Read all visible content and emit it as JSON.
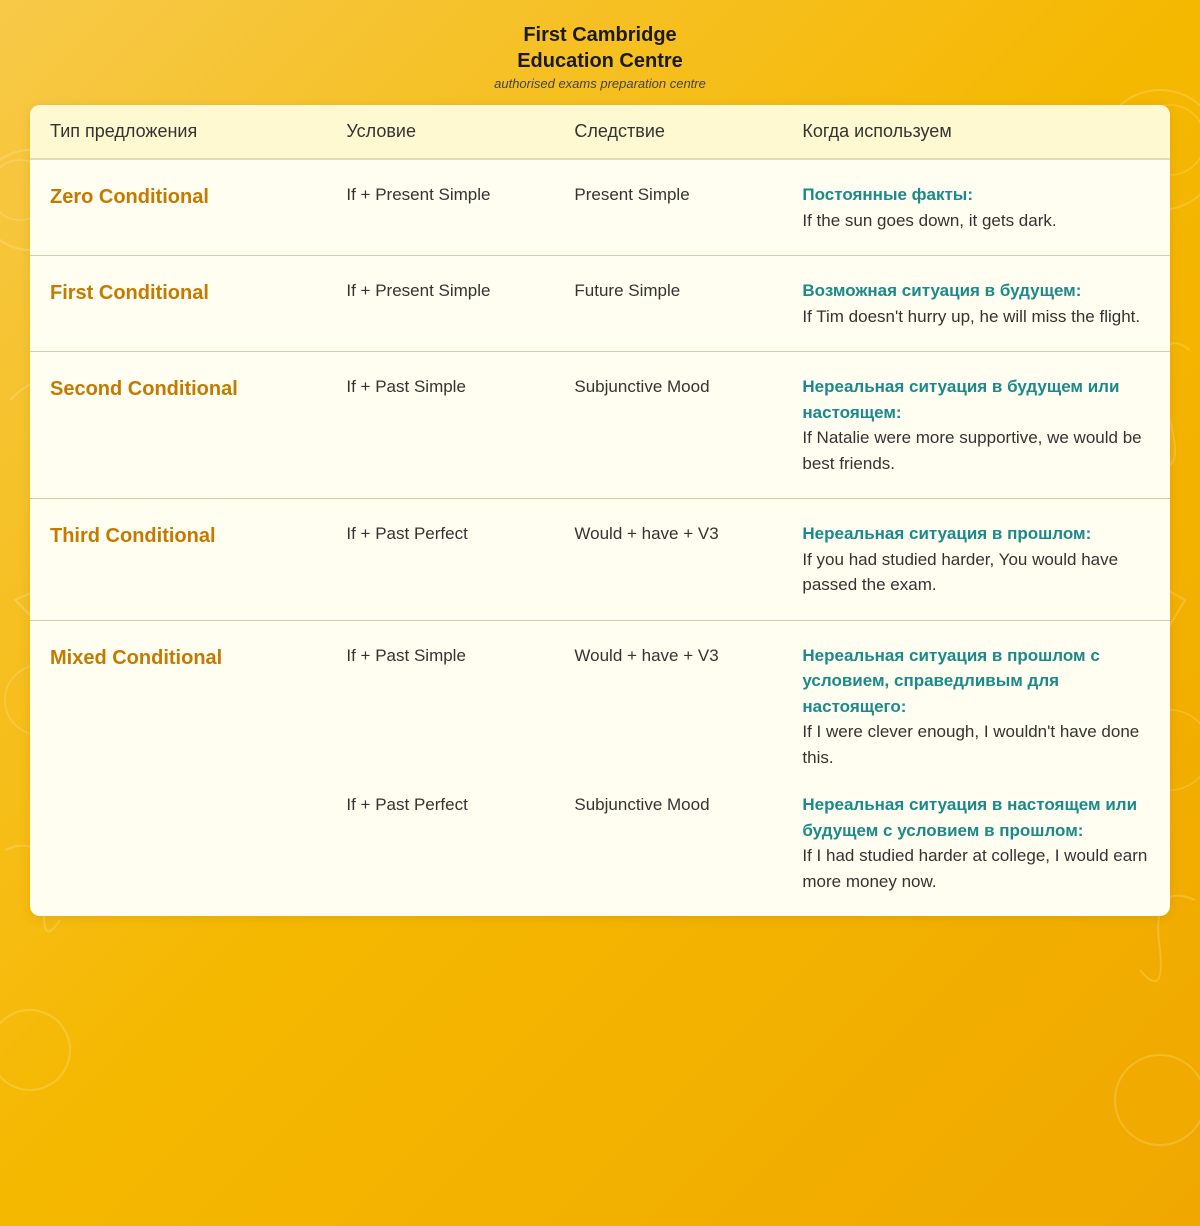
{
  "header": {
    "title_line1": "First Cambridge",
    "title_line2": "Education Centre",
    "subtitle": "authorised exams preparation centre"
  },
  "table": {
    "columns": [
      "Тип предложения",
      "Условие",
      "Следствие",
      "Когда используем"
    ],
    "rows": [
      {
        "type": "Zero Conditional",
        "condition": "If + Present Simple",
        "consequence": "Present Simple",
        "when_bold": "Постоянные факты:",
        "when_text": "If the sun goes down, it gets dark."
      },
      {
        "type": "First Conditional",
        "condition": "If + Present Simple",
        "consequence": "Future Simple",
        "when_bold": "Возможная ситуация в будущем:",
        "when_text": "If Tim doesn't hurry up, he will miss the flight."
      },
      {
        "type": "Second Conditional",
        "condition": "If + Past Simple",
        "consequence": "Subjunctive Mood",
        "when_bold": "Нереальная ситуация в будущем или настоящем:",
        "when_text": "If Natalie were more supportive, we would be best friends."
      },
      {
        "type": "Third Conditional",
        "condition": "If + Past Perfect",
        "consequence": "Would + have + V3",
        "when_bold": "Нереальная ситуация в прошлом:",
        "when_text": "If you had studied harder, You would have passed the exam."
      },
      {
        "type": "Mixed Conditional",
        "condition": "If + Past Simple",
        "consequence": "Would + have + V3",
        "when_bold": "Нереальная ситуация в прошлом с условием, справедливым для настоящего:",
        "when_text": "If I were clever enough, I wouldn't have done this.",
        "sub_condition": "If + Past Perfect",
        "sub_consequence": "Subjunctive Mood",
        "sub_when_bold": "Нереальная ситуация в настоящем или будущем с условием в прошлом:",
        "sub_when_text": "If I had studied harder at college, I would earn more money now."
      }
    ]
  }
}
